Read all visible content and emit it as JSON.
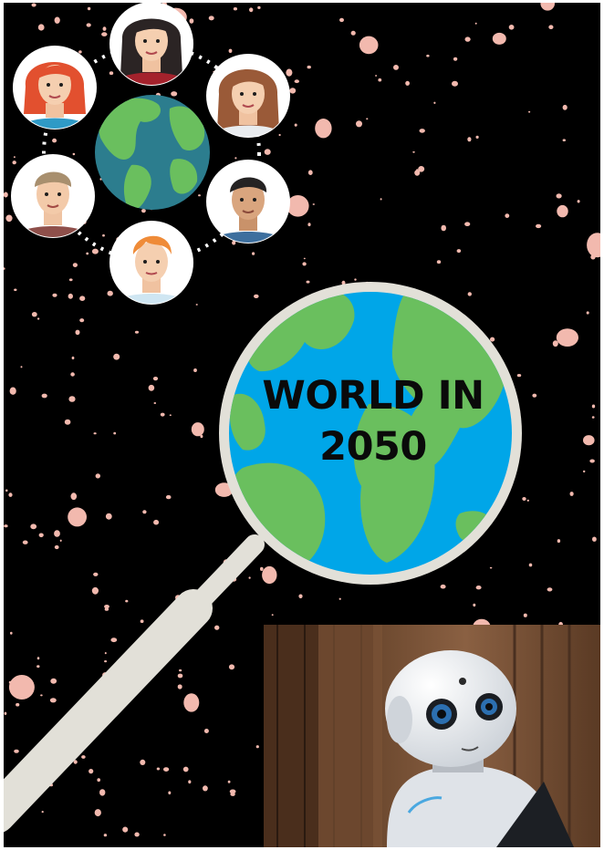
{
  "poster": {
    "title_line1": "WORLD IN",
    "title_line2": "2050"
  },
  "colors": {
    "background": "#000000",
    "speckle": "#f2b9ae",
    "ocean": "#00a6e8",
    "land": "#6abf5e",
    "magnifier": "#e2e0d8",
    "title_text": "#0a0a0a"
  },
  "illustrations": {
    "avatar_ring": [
      "woman-avatar-icon",
      "woman-avatar-icon",
      "woman-avatar-icon",
      "man-avatar-icon",
      "man-avatar-icon",
      "man-avatar-icon"
    ],
    "center_globe": "globe-icon",
    "magnifier": "magnifying-glass-icon",
    "photo": "robot-photo"
  }
}
